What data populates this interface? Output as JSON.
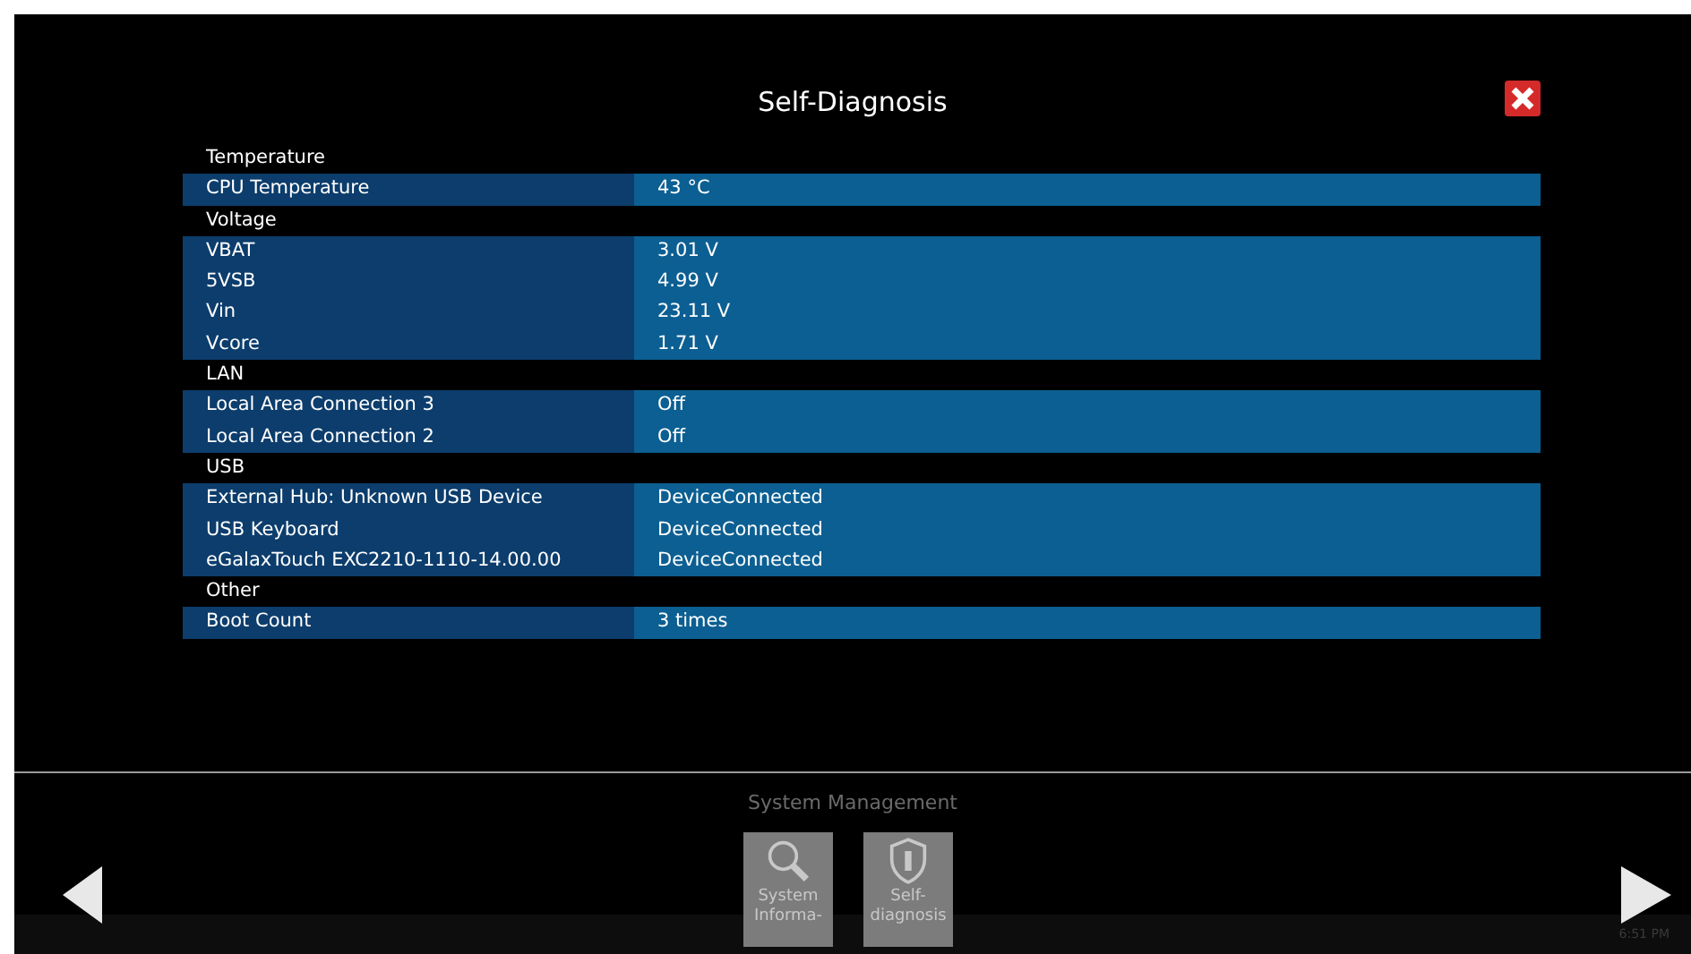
{
  "dialog": {
    "title": "Self-Diagnosis"
  },
  "sections": [
    {
      "heading": "Temperature",
      "rows": [
        {
          "label": "CPU Temperature",
          "value": "43 °C"
        }
      ]
    },
    {
      "heading": "Voltage",
      "rows": [
        {
          "label": "VBAT",
          "value": "3.01 V"
        },
        {
          "label": "5VSB",
          "value": "4.99 V"
        },
        {
          "label": "Vin",
          "value": "23.11 V"
        },
        {
          "label": "Vcore",
          "value": "1.71 V"
        }
      ]
    },
    {
      "heading": "LAN",
      "rows": [
        {
          "label": "Local Area Connection 3",
          "value": "Off"
        },
        {
          "label": "Local Area Connection 2",
          "value": "Off"
        }
      ]
    },
    {
      "heading": "USB",
      "rows": [
        {
          "label": "External Hub: Unknown USB Device",
          "value": "DeviceConnected"
        },
        {
          "label": "USB Keyboard",
          "value": "DeviceConnected"
        },
        {
          "label": "eGalaxTouch EXC2210-1110-14.00.00",
          "value": "DeviceConnected"
        }
      ]
    },
    {
      "heading": "Other",
      "rows": [
        {
          "label": "Boot Count",
          "value": "3 times"
        }
      ]
    }
  ],
  "footer": {
    "title": "System Management",
    "tiles": [
      {
        "kind": "search",
        "label": "System Informa-"
      },
      {
        "kind": "shield",
        "label": "Self-diagnosis"
      }
    ]
  },
  "taskbar": {
    "clock": "6:51 PM"
  }
}
